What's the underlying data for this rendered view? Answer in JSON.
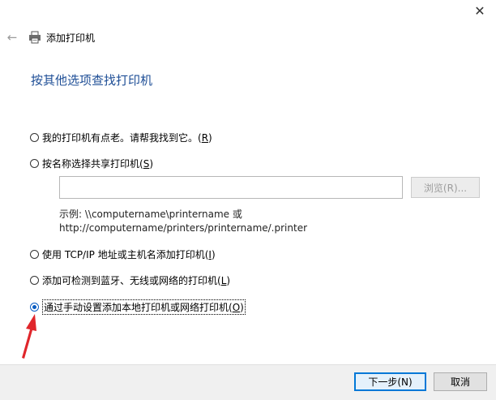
{
  "window": {
    "title": "添加打印机",
    "close_glyph": "✕",
    "back_glyph": "←"
  },
  "heading": "按其他选项查找打印机",
  "options": [
    {
      "label": "我的打印机有点老。请帮我找到它。",
      "accel": "R",
      "checked": false
    },
    {
      "label": "按名称选择共享打印机",
      "accel": "S",
      "checked": false
    },
    {
      "label": "使用 TCP/IP 地址或主机名添加打印机",
      "accel": "I",
      "checked": false
    },
    {
      "label": "添加可检测到蓝牙、无线或网络的打印机",
      "accel": "L",
      "checked": false
    },
    {
      "label": "通过手动设置添加本地打印机或网络打印机",
      "accel": "O",
      "checked": true
    }
  ],
  "share": {
    "input_value": "",
    "browse_label": "浏览(R)...",
    "example_line1": "示例: \\\\computername\\printername 或",
    "example_line2": "http://computername/printers/printername/.printer"
  },
  "buttons": {
    "next_label": "下一步(N)",
    "cancel_label": "取消"
  },
  "colors": {
    "heading": "#1e4e96",
    "accent": "#0078d7",
    "arrow": "#e0262b"
  }
}
